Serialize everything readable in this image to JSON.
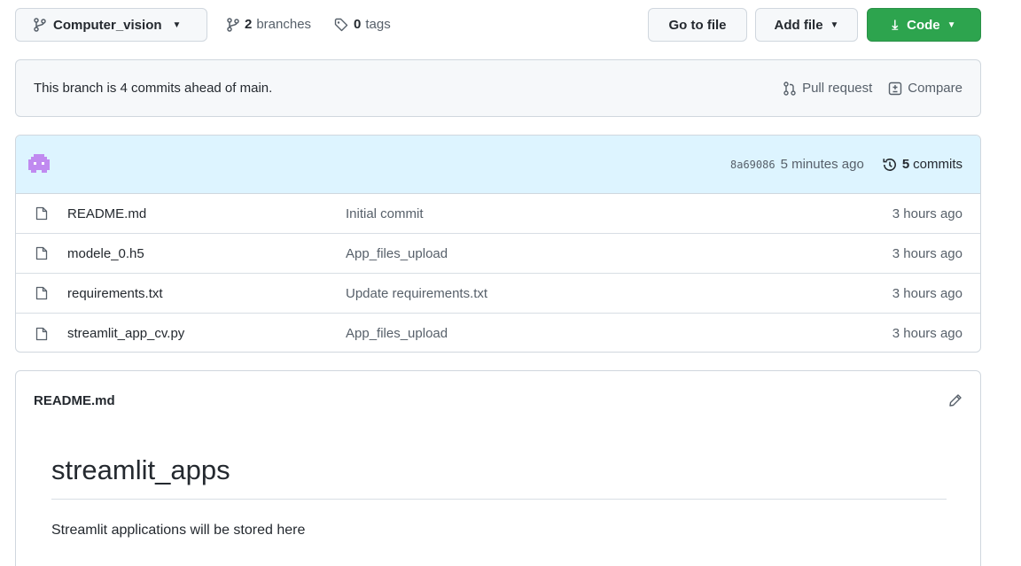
{
  "toolbar": {
    "branch_label": "Computer_vision",
    "branches_count": "2",
    "branches_label": "branches",
    "tags_count": "0",
    "tags_label": "tags",
    "goto_label": "Go to file",
    "addfile_label": "Add file",
    "code_label": "Code",
    "code_color": "#2da44e"
  },
  "branch_status": {
    "message": "This branch is 4 commits ahead of main.",
    "pull_request_label": "Pull request",
    "compare_label": "Compare"
  },
  "latest_commit": {
    "avatar_icon": "pixel-avatar-icon",
    "sha": "8a69086",
    "time": "5 minutes ago",
    "commits_count": "5",
    "commits_label": "commits",
    "header_color": "#ddf4ff"
  },
  "files": [
    {
      "name": "README.md",
      "message": "Initial commit",
      "age": "3 hours ago"
    },
    {
      "name": "modele_0.h5",
      "message": "App_files_upload",
      "age": "3 hours ago"
    },
    {
      "name": "requirements.txt",
      "message": "Update requirements.txt",
      "age": "3 hours ago"
    },
    {
      "name": "streamlit_app_cv.py",
      "message": "App_files_upload",
      "age": "3 hours ago"
    }
  ],
  "readme": {
    "filename": "README.md",
    "heading": "streamlit_apps",
    "text": "Streamlit applications will be stored here"
  }
}
